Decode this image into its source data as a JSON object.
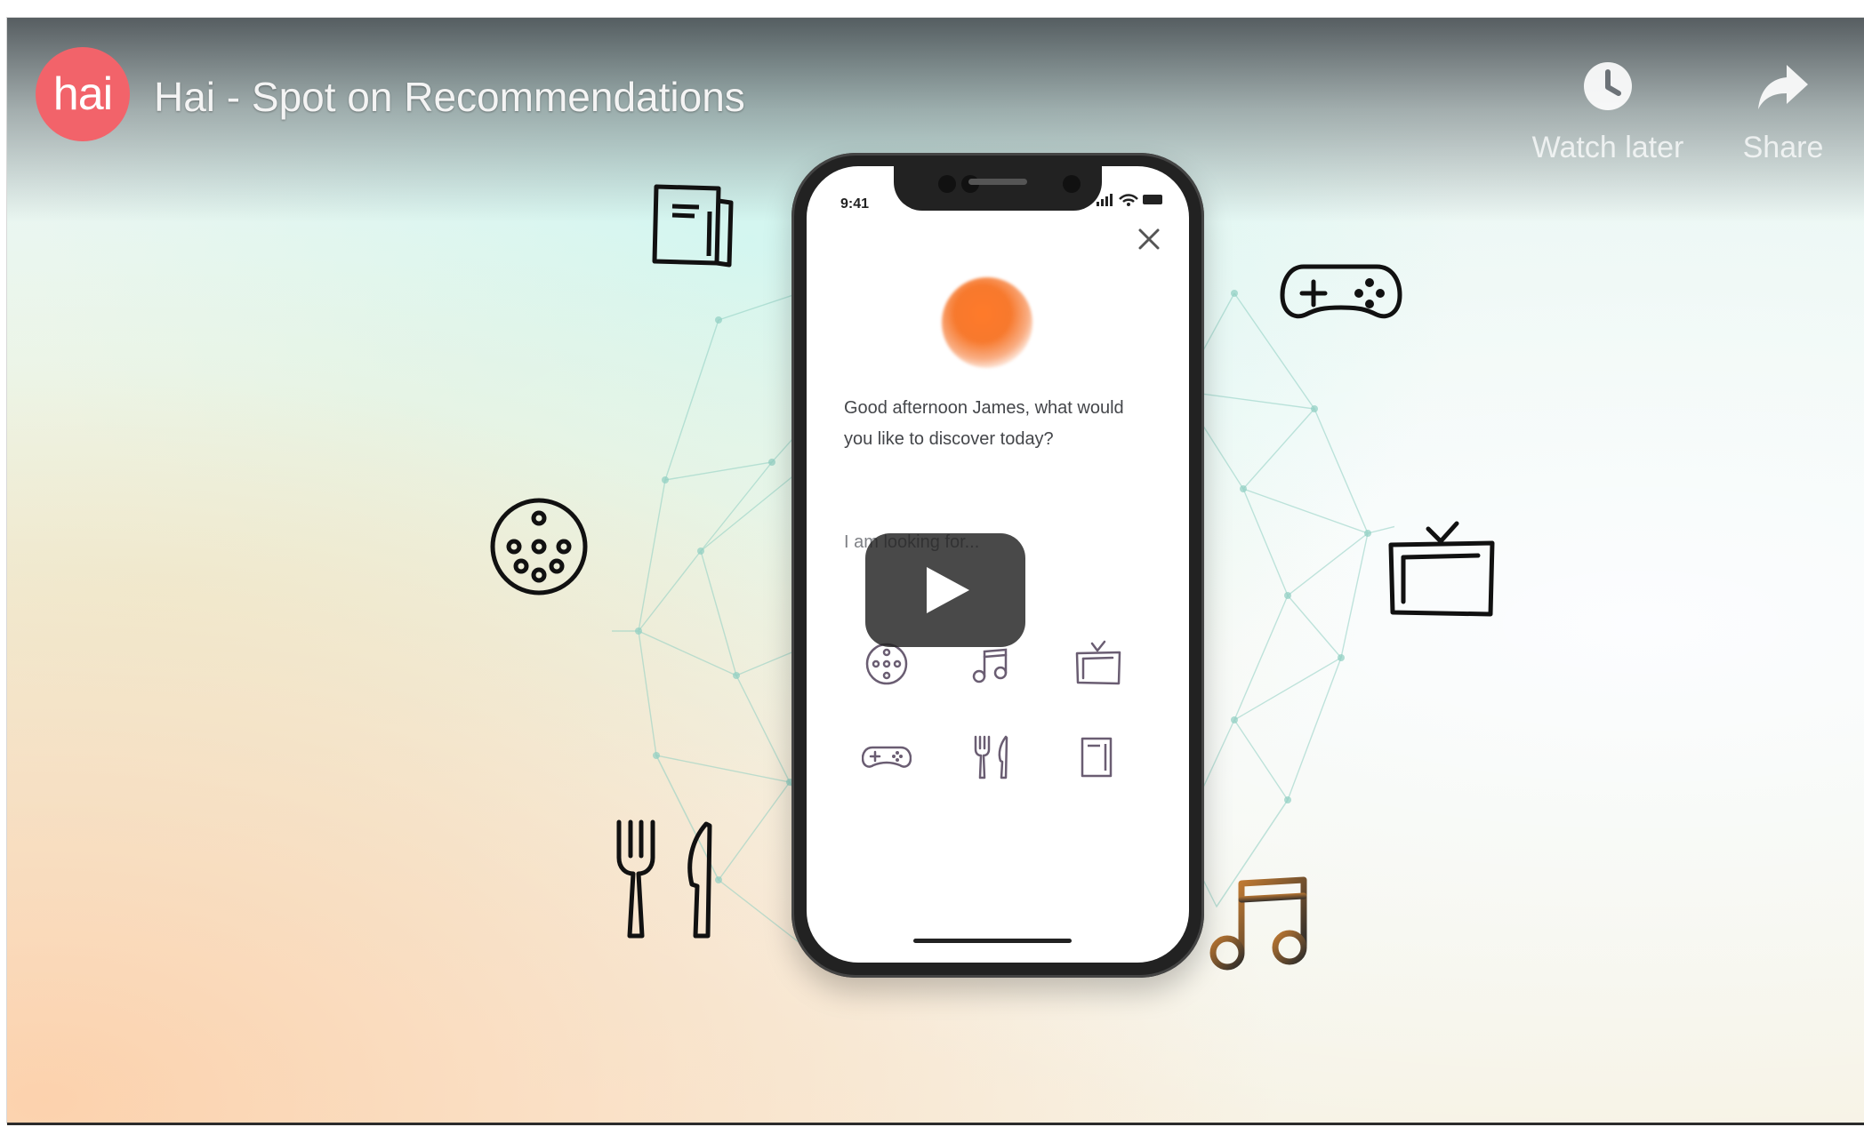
{
  "header": {
    "channel_logo_text": "hai",
    "title": "Hai - Spot on Recommendations",
    "actions": [
      {
        "label": "Watch later",
        "icon": "clock-icon"
      },
      {
        "label": "Share",
        "icon": "share-arrow-icon"
      }
    ]
  },
  "phone": {
    "status_time": "9:41",
    "greeting": "Good afternoon James, what would you like to discover today?",
    "prompt": "I am looking for...",
    "categories": [
      {
        "icon": "film-reel-icon"
      },
      {
        "icon": "music-note-icon"
      },
      {
        "icon": "tv-icon"
      },
      {
        "icon": "gamepad-icon"
      },
      {
        "icon": "fork-knife-icon"
      },
      {
        "icon": "book-icon"
      }
    ]
  },
  "floating_icons": [
    "book-icon",
    "gamepad-icon",
    "film-reel-icon",
    "tv-icon",
    "fork-knife-icon",
    "music-note-icon"
  ],
  "colors": {
    "logo": "#f2636a",
    "orb": "#f7792d",
    "music_note_gradient": [
      "#c07a32",
      "#2a2a2a"
    ],
    "play_button": "#212121"
  }
}
